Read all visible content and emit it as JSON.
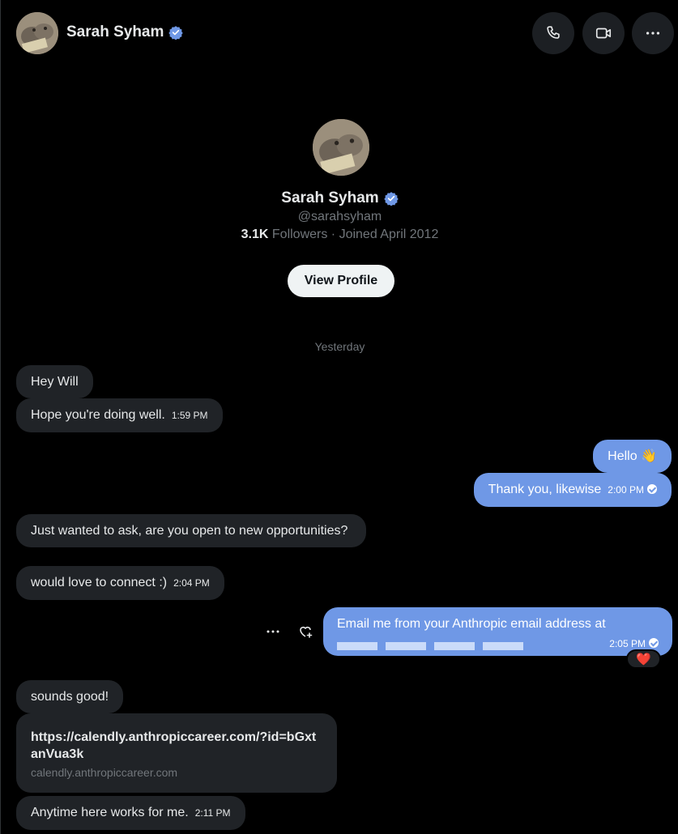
{
  "header": {
    "name": "Sarah Syham",
    "call_icon": "phone-icon",
    "video_icon": "video-icon",
    "more_icon": "more-icon"
  },
  "profile": {
    "name": "Sarah Syham",
    "handle": "@sarahsyham",
    "followers_count": "3.1K",
    "followers_rest": " Followers · Joined April 2012",
    "view_profile_label": "View Profile"
  },
  "day_separator": "Yesterday",
  "messages": [
    {
      "side": "in",
      "text": "Hey Will",
      "time": ""
    },
    {
      "side": "in",
      "text": "Hope you're doing well.",
      "time": "1:59 PM"
    },
    {
      "side": "out",
      "text": "Hello 👋",
      "time": ""
    },
    {
      "side": "out",
      "text": "Thank you, likewise",
      "time": "2:00 PM"
    },
    {
      "side": "in",
      "text": "Just wanted to ask, are you open to new opportunities?",
      "time": ""
    },
    {
      "side": "in",
      "text": "would love to connect :)",
      "time": "2:04 PM"
    },
    {
      "side": "out",
      "text": "Email me from your Anthropic email address at",
      "time": "2:05 PM",
      "reaction": "❤️"
    },
    {
      "side": "in",
      "text": "sounds good!",
      "time": ""
    },
    {
      "side": "in",
      "type": "link",
      "url": "https://calendly.anthropiccareer.com/?id=bGxtanVua3k",
      "domain": "calendly.anthropiccareer.com"
    },
    {
      "side": "in",
      "text": "Anytime here works for me.",
      "time": "2:11 PM"
    }
  ],
  "colors": {
    "background": "#000000",
    "incoming_bubble": "#202327",
    "outgoing_bubble": "#6f98e6",
    "verified": "#6f98e6"
  }
}
